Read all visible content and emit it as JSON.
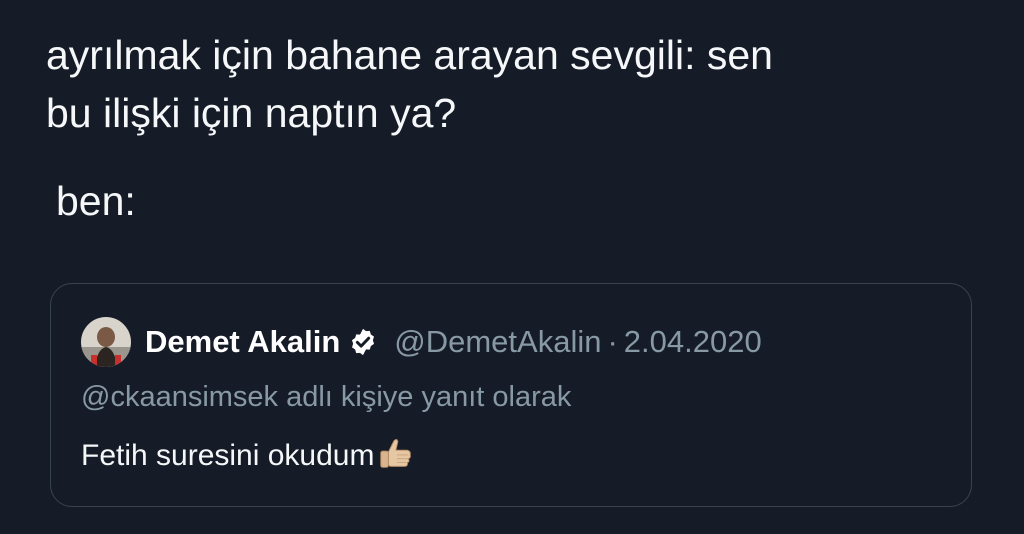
{
  "tweet": {
    "text_line1": "ayrılmak için bahane arayan sevgili: sen",
    "text_line2": "bu ilişki için naptın ya?",
    "text_line3": "ben:"
  },
  "quoted_tweet": {
    "avatar_icon": "user-avatar",
    "display_name": "Demet Akalin",
    "verified_icon": "verified-badge-icon",
    "handle": "@DemetAkalin",
    "separator": "·",
    "date": "2.04.2020",
    "reply_context": "@ckaansimsek adlı kişiye yanıt olarak",
    "body": "Fetih suresini okudum",
    "emoji_icon": "thumbs-up-icon"
  },
  "colors": {
    "background": "#161c27",
    "border": "#38444d",
    "secondary_text": "#8899a6",
    "primary_text": "#f5f7f9"
  }
}
